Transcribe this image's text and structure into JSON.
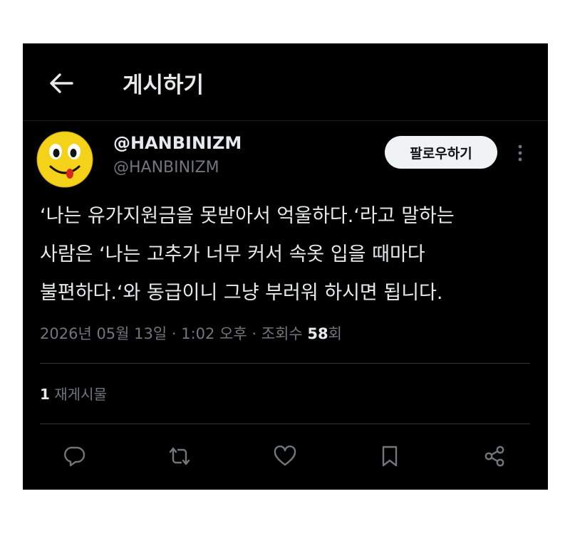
{
  "header": {
    "title": "게시하기"
  },
  "post": {
    "author_name": "@HANBINIZM",
    "author_handle": "@HANBINIZM",
    "follow_label": "팔로우하기",
    "text_lines": [
      "‘나는 유가지원금을 못받아서 억울하다.‘라고 말하는",
      "사람은 ‘나는 고추가 너무 커서 속옷 입을 때마다",
      "불편하다.‘와 동급이니 그냥 부러워 하시면 됩니다."
    ],
    "date": "2026년 05월 13일",
    "separator": " · ",
    "time": "1:02 오후",
    "views_label_prefix": "조회수 ",
    "views_count": "58",
    "views_label_suffix": "회",
    "reposts_count": "1",
    "reposts_label": " 재게시물"
  },
  "icons": {
    "back": "arrow-left-icon",
    "more": "more-vertical-icon",
    "reply": "reply-icon",
    "repost": "repost-icon",
    "like": "heart-icon",
    "bookmark": "bookmark-icon",
    "share": "share-icon"
  },
  "colors": {
    "background": "#000000",
    "text": "#e7e9ea",
    "muted": "#71767b",
    "follow_bg": "#eff3f4"
  }
}
